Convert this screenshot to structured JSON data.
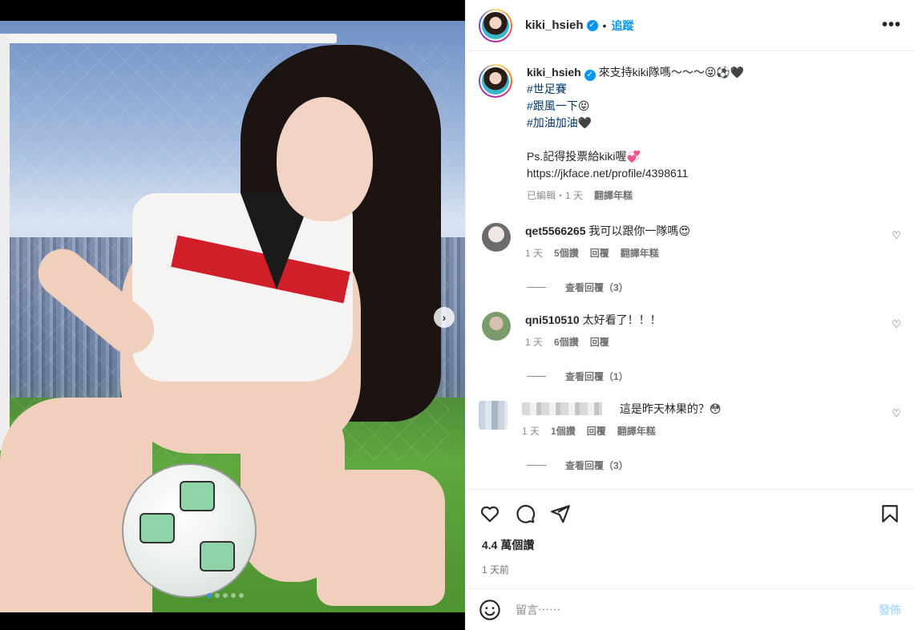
{
  "header": {
    "username": "kiki_hsieh",
    "separator": "•",
    "follow_label": "追蹤",
    "more_label": "•••"
  },
  "caption": {
    "username": "kiki_hsieh",
    "line1": "來支持kiki隊嗎～～～😝⚽️🖤",
    "tag1": "#世足賽",
    "tag2": "#跟風一下",
    "tag2_suffix": "😝",
    "tag3": "#加油加油",
    "tag3_suffix": "🖤",
    "line_ps": "Ps.記得投票給kiki喔💞",
    "link": "https://jkface.net/profile/4398611",
    "meta_edited": "已編輯・1 天",
    "meta_translate": "翻譯年糕"
  },
  "comments": [
    {
      "username": "qet5566265",
      "text": "我可以跟你一隊嗎😍",
      "time": "1 天",
      "likes": "5個讚",
      "reply": "回覆",
      "translate": "翻譯年糕",
      "view_replies": "查看回覆（3）"
    },
    {
      "username": "qni510510",
      "text": "太好看了！！！",
      "time": "1 天",
      "likes": "6個讚",
      "reply": "回覆",
      "translate": "",
      "view_replies": "查看回覆（1）"
    },
    {
      "username": "",
      "text": "這是昨天林果的？😳",
      "time": "1 天",
      "likes": "1個讚",
      "reply": "回覆",
      "translate": "翻譯年糕",
      "view_replies": "查看回覆（3）"
    }
  ],
  "stats": {
    "likes": "4.4 萬個讚",
    "date": "1 天前"
  },
  "composer": {
    "placeholder": "留言⋯⋯",
    "post_label": "發佈"
  },
  "media": {
    "next_label": "›",
    "dots": 5,
    "active_dot": 0
  },
  "colors": {
    "accent": "#0095f6",
    "hashtag": "#00376b",
    "muted": "#737373"
  }
}
